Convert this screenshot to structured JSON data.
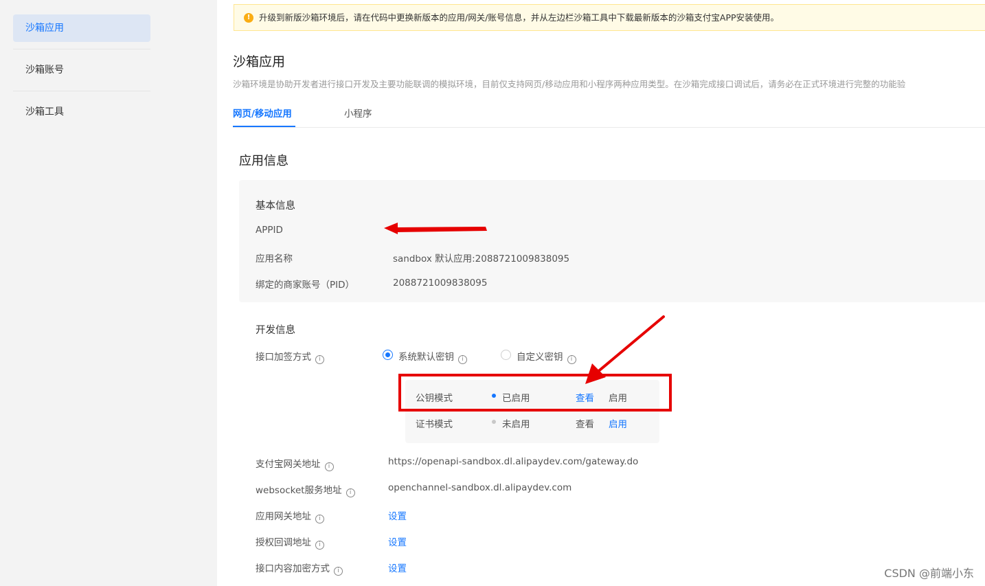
{
  "sidebar": {
    "items": [
      {
        "label": "沙箱应用"
      },
      {
        "label": "沙箱账号"
      },
      {
        "label": "沙箱工具"
      }
    ]
  },
  "notice": {
    "text": "升级到新版沙箱环境后，请在代码中更换新版本的应用/网关/账号信息，并从左边栏沙箱工具中下载最新版本的沙箱支付宝APP安装使用。"
  },
  "page": {
    "title": "沙箱应用",
    "description": "沙箱环境是协助开发者进行接口开发及主要功能联调的模拟环境，目前仅支持网页/移动应用和小程序两种应用类型。在沙箱完成接口调试后，请务必在正式环境进行完整的功能验"
  },
  "tabs": [
    {
      "label": "网页/移动应用"
    },
    {
      "label": "小程序"
    }
  ],
  "app_info": {
    "section_title": "应用信息",
    "basic": {
      "title": "基本信息",
      "appid_label": "APPID",
      "name_label": "应用名称",
      "name_value": "sandbox 默认应用:2088721009838095",
      "pid_label": "绑定的商家账号（PID）",
      "pid_value": "2088721009838095"
    },
    "dev": {
      "title": "开发信息",
      "sign_label": "接口加签方式",
      "option_default": "系统默认密钥",
      "option_custom": "自定义密钥",
      "modes": [
        {
          "name": "公钥模式",
          "status": "已启用",
          "view": "查看",
          "enable": "启用"
        },
        {
          "name": "证书模式",
          "status": "未启用",
          "view": "查看",
          "enable": "启用"
        }
      ],
      "gateway_label": "支付宝网关地址",
      "gateway_value": "https://openapi-sandbox.dl.alipaydev.com/gateway.do",
      "ws_label": "websocket服务地址",
      "ws_value": "openchannel-sandbox.dl.alipaydev.com",
      "app_gateway_label": "应用网关地址",
      "callback_label": "授权回调地址",
      "encrypt_label": "接口内容加密方式",
      "set_label": "设置"
    }
  },
  "watermark": "CSDN @前端小东",
  "colors": {
    "accent": "#1677ff",
    "annotation_red": "#e60000",
    "warning": "#faad14"
  }
}
